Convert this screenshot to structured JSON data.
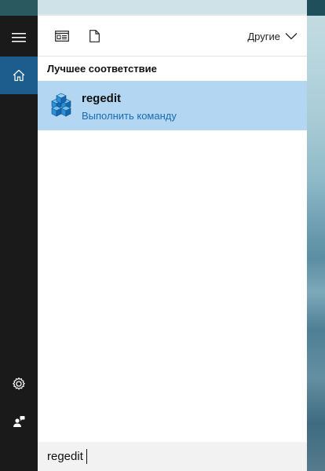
{
  "rail": {
    "menu_icon": "hamburger-icon",
    "home_icon": "home-icon",
    "settings_icon": "gear-icon",
    "feedback_icon": "feedback-person-icon",
    "accent_color": "#1d5d8e"
  },
  "toolbar": {
    "apps_icon": "apps-filter-icon",
    "documents_icon": "document-icon",
    "others_label": "Другие",
    "others_icon": "chevron-down-icon"
  },
  "results": {
    "section_title": "Лучшее соответствие",
    "best_match": {
      "name": "regedit",
      "action": "Выполнить команду",
      "icon": "registry-editor-icon",
      "highlight_color": "#b3d6f3"
    }
  },
  "search": {
    "value": "regedit"
  }
}
